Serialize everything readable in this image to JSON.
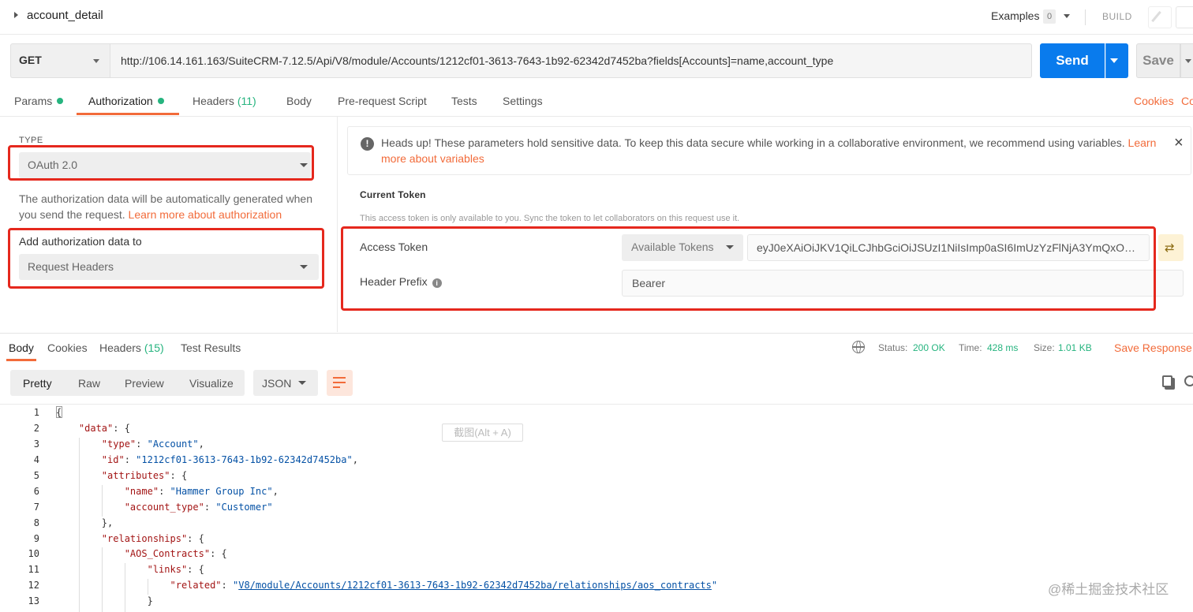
{
  "request": {
    "name": "account_detail",
    "examples_label": "Examples",
    "examples_count": "0",
    "build_label": "BUILD",
    "method": "GET",
    "url": "http://106.14.161.163/SuiteCRM-7.12.5/Api/V8/module/Accounts/1212cf01-3613-7643-1b92-62342d7452ba?fields[Accounts]=name,account_type",
    "send_label": "Send",
    "save_label": "Save"
  },
  "request_tabs": {
    "params": "Params",
    "authorization": "Authorization",
    "headers": "Headers",
    "headers_count": "(11)",
    "body": "Body",
    "prerequest": "Pre-request Script",
    "tests": "Tests",
    "settings": "Settings",
    "cookies": "Cookies",
    "code": "Co"
  },
  "auth": {
    "type_label": "TYPE",
    "type_value": "OAuth 2.0",
    "description": "The authorization data will be automatically generated when you send the request.",
    "learn_more": "Learn more about authorization",
    "add_to_label": "Add authorization data to",
    "add_to_value": "Request Headers"
  },
  "notice": {
    "text": "Heads up! These parameters hold sensitive data. To keep this data secure while working in a collaborative environment, we recommend using variables.",
    "link": "Learn more about variables",
    "close": "×"
  },
  "token": {
    "section_title": "Current Token",
    "note": "This access token is only available to you. Sync the token to let collaborators on this request use it.",
    "access_token_label": "Access Token",
    "available_tokens": "Available Tokens",
    "access_token_value": "eyJ0eXAiOiJKV1QiLCJhbGciOiJSUzI1NiIsImp0aSI6ImUzYzFlNjA3YmQxOGZhYzcx...",
    "header_prefix_label": "Header Prefix",
    "header_prefix_value": "Bearer"
  },
  "response": {
    "tabs": {
      "body": "Body",
      "cookies": "Cookies",
      "headers": "Headers",
      "headers_count": "(15)",
      "test_results": "Test Results"
    },
    "status_label": "Status:",
    "status_value": "200 OK",
    "time_label": "Time:",
    "time_value": "428 ms",
    "size_label": "Size:",
    "size_value": "1.01 KB",
    "save_response": "Save Response",
    "views": [
      "Pretty",
      "Raw",
      "Preview",
      "Visualize"
    ],
    "format": "JSON"
  },
  "code": {
    "line_numbers": [
      "1",
      "2",
      "3",
      "4",
      "5",
      "6",
      "7",
      "8",
      "9",
      "10",
      "11",
      "12",
      "13"
    ],
    "type_value": "\"Account\"",
    "id_value": "\"1212cf01-3613-7643-1b92-62342d7452ba\"",
    "name_value": "\"Hammer Group Inc\"",
    "account_type_value": "\"Customer\"",
    "related_value": "V8/module/Accounts/1212cf01-3613-7643-1b92-62342d7452ba/relationships/aos_contracts"
  },
  "overlay": {
    "tooltip": "截图(Alt + A)",
    "watermark": "@稀土掘金技术社区"
  },
  "colors": {
    "accent": "#f26b3a",
    "send_blue": "#097bed",
    "success_green": "#26b47f",
    "highlight_red": "#e5281d"
  },
  "icons": [
    "caret-right-icon",
    "pencil-icon",
    "info-icon",
    "close-icon",
    "sync-token-icon",
    "globe-icon",
    "wrap-icon",
    "copy-icon",
    "search-icon"
  ]
}
